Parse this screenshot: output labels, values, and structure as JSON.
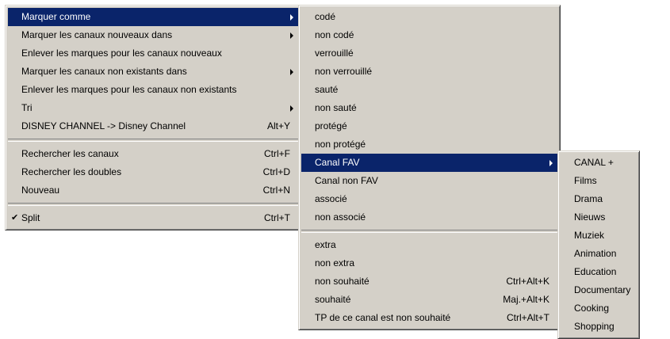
{
  "menu1": {
    "items": [
      {
        "label": "Marquer comme",
        "shortcut": "",
        "submenu": true
      },
      {
        "label": "Marquer les canaux nouveaux dans",
        "shortcut": "",
        "submenu": true
      },
      {
        "label": "Enlever les marques pour les canaux nouveaux",
        "shortcut": ""
      },
      {
        "label": "Marquer les canaux non existants dans",
        "shortcut": "",
        "submenu": true
      },
      {
        "label": "Enlever les marques pour les canaux non existants",
        "shortcut": ""
      },
      {
        "label": "Tri",
        "shortcut": "",
        "submenu": true
      },
      {
        "label": "DISNEY CHANNEL -> Disney Channel",
        "shortcut": "Alt+Y"
      },
      {
        "label": "Rechercher les canaux",
        "shortcut": "Ctrl+F"
      },
      {
        "label": "Rechercher les doubles",
        "shortcut": "Ctrl+D"
      },
      {
        "label": "Nouveau",
        "shortcut": "Ctrl+N"
      },
      {
        "label": "Split",
        "shortcut": "Ctrl+T",
        "checked": "✔"
      }
    ]
  },
  "menu2": {
    "items": [
      {
        "label": "codé"
      },
      {
        "label": "non codé"
      },
      {
        "label": "verrouillé"
      },
      {
        "label": "non verrouillé"
      },
      {
        "label": "sauté"
      },
      {
        "label": "non sauté"
      },
      {
        "label": "protégé"
      },
      {
        "label": "non protégé"
      },
      {
        "label": "Canal FAV",
        "submenu": true
      },
      {
        "label": "Canal non FAV"
      },
      {
        "label": "associé"
      },
      {
        "label": "non associé"
      },
      {
        "label": "extra"
      },
      {
        "label": "non extra"
      },
      {
        "label": "non souhaité",
        "shortcut": "Ctrl+Alt+K"
      },
      {
        "label": "souhaité",
        "shortcut": "Maj.+Alt+K"
      },
      {
        "label": "TP de ce canal est non souhaité",
        "shortcut": "Ctrl+Alt+T"
      }
    ]
  },
  "menu3": {
    "items": [
      {
        "label": "CANAL +"
      },
      {
        "label": "Films"
      },
      {
        "label": "Drama"
      },
      {
        "label": "Nieuws"
      },
      {
        "label": "Muziek"
      },
      {
        "label": "Animation"
      },
      {
        "label": "Education"
      },
      {
        "label": "Documentary"
      },
      {
        "label": "Cooking"
      },
      {
        "label": "Shopping"
      }
    ]
  },
  "colors": {
    "menu_bg": "#d4d0c8",
    "highlight": "#0a246a",
    "highlight_text": "#ffffff"
  }
}
